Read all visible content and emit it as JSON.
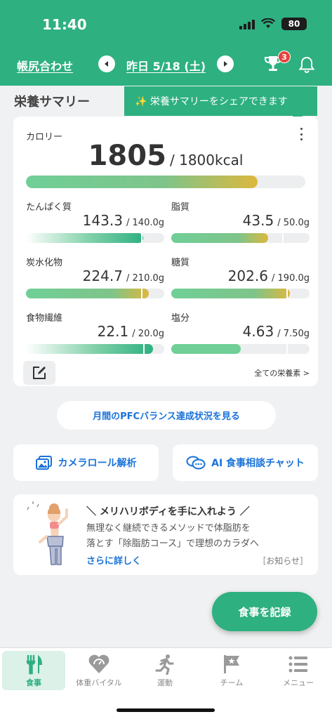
{
  "status_bar": {
    "time": "11:40",
    "battery": "80"
  },
  "header": {
    "reconcile_link": "帳尻合わせ",
    "date_label": "昨日 5/18 (土)",
    "trophy_badge_count": "3"
  },
  "summary": {
    "title": "栄養サマリー",
    "share_tooltip": "✨ 栄養サマリーをシェアできます",
    "calorie": {
      "label": "カロリー",
      "value": "1805",
      "target": "/ 1800kcal",
      "progress": 0.83
    },
    "nutrients": [
      {
        "label": "たんぱく質",
        "value": "143.3",
        "target": "/ 140.0g",
        "fill": 0.85,
        "marker": 0.83,
        "style": "green-fade"
      },
      {
        "label": "脂質",
        "value": "43.5",
        "target": "/ 50.0g",
        "fill": 0.7,
        "marker": 0.8,
        "style": "green-yellow"
      },
      {
        "label": "炭水化物",
        "value": "224.7",
        "target": "/ 210.0g",
        "fill": 0.89,
        "marker": 0.83,
        "style": "green-yellow"
      },
      {
        "label": "糖質",
        "value": "202.6",
        "target": "/ 190.0g",
        "fill": 0.86,
        "marker": 0.83,
        "style": "green-yellow"
      },
      {
        "label": "食物繊維",
        "value": "22.1",
        "target": "/ 20.0g",
        "fill": 0.92,
        "marker": 0.85,
        "style": "green-fade"
      },
      {
        "label": "塩分",
        "value": "4.63",
        "target": "/ 7.50g",
        "fill": 0.5,
        "marker": 0.83,
        "style": "green"
      }
    ],
    "all_nutrients_link": "全ての栄養素 >"
  },
  "pfc_button": "月間のPFCバランス達成状況を見る",
  "actions": {
    "camera_roll": "カメラロール解析",
    "ai_chat": "AI 食事相談チャット"
  },
  "banner": {
    "title": "＼ メリハリボディを手に入れよう ／",
    "line1": "無理なく継続できるメソッドで体脂肪を",
    "line2": "落とす「除脂肪コース」で理想のカラダへ",
    "more_link": "さらに詳しく",
    "tag": "［お知らせ］"
  },
  "fab_label": "食事を記録",
  "tabs": [
    {
      "label": "食事",
      "icon": "fork-knife-icon",
      "active": true
    },
    {
      "label": "体重バイタル",
      "icon": "heart-scale-icon",
      "active": false
    },
    {
      "label": "運動",
      "icon": "runner-icon",
      "active": false
    },
    {
      "label": "チーム",
      "icon": "flag-star-icon",
      "active": false
    },
    {
      "label": "メニュー",
      "icon": "menu-list-icon",
      "active": false
    }
  ],
  "colors": {
    "brand": "#2eb081",
    "link": "#1a73d9",
    "badge": "#e8413c",
    "warning": "#dcb83e"
  }
}
